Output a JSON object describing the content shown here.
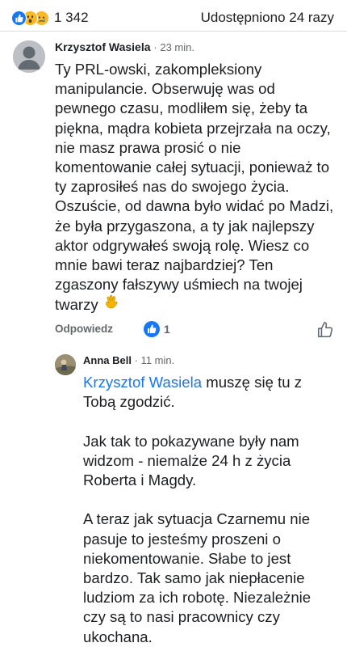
{
  "reactions": {
    "icons": [
      "like-icon",
      "wow-icon",
      "sad-icon"
    ],
    "count": "1 342"
  },
  "shares_text": "Udostępniono 24 razy",
  "comment": {
    "author": "Krzysztof Wasiela",
    "time": "· 23 min.",
    "text": "Ty PRL-owski, zakompleksiony manipulancie. Obserwuję was od pewnego czasu, modliłem się, żeby ta piękna, mądra kobieta przejrzała na oczy, nie masz prawa prosić o nie komentowanie całej sytuacji, ponieważ to ty zaprosiłeś nas do swojego życia. Oszuście, od dawna było widać po Madzi, że była przygaszona, a ty jak najlepszy aktor odgrywałeś swoją rolę. Wiesz co mnie bawi teraz najbardziej? Ten zgaszony fałszywy uśmiech na twojej twarzy",
    "emoji_icon": "waving-hand-icon",
    "reply_label": "Odpowiedz",
    "like_count": "1"
  },
  "reply": {
    "author": "Anna Bell",
    "time": "· 11 min.",
    "mention": "Krzysztof Wasiela",
    "p1_rest": " muszę się tu z Tobą zgodzić.",
    "p2": "Jak tak to pokazywane były nam widzom - niemalże 24 h z życia Roberta i Magdy.",
    "p3": "A teraz jak sytuacja Czarnemu nie pasuje to jesteśmy proszeni o niekomentowanie. Słabe to jest bardzo. Tak samo jak niepłacenie ludziom za ich robotę. Niezależnie czy są to nasi pracownicy czy ukochana."
  },
  "colors": {
    "link": "#1877f2",
    "secondary_text": "#65676b",
    "like_blue": "#1877f2",
    "reaction_yellow": "#f7b928"
  }
}
